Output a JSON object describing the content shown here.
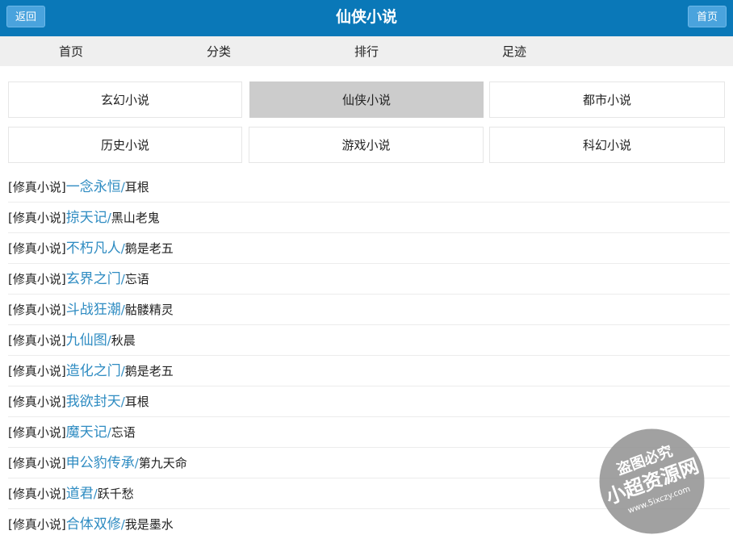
{
  "header": {
    "back_label": "返回",
    "title": "仙侠小说",
    "home_label": "首页",
    "bar_color": "#0a78b8"
  },
  "nav": {
    "items": [
      {
        "label": "首页"
      },
      {
        "label": "分类"
      },
      {
        "label": "排行"
      },
      {
        "label": "足迹"
      }
    ]
  },
  "categories": [
    {
      "label": "玄幻小说",
      "active": false
    },
    {
      "label": "仙侠小说",
      "active": true
    },
    {
      "label": "都市小说",
      "active": false
    },
    {
      "label": "历史小说",
      "active": false
    },
    {
      "label": "游戏小说",
      "active": false
    },
    {
      "label": "科幻小说",
      "active": false
    }
  ],
  "books": [
    {
      "tag": "[修真小说]",
      "title": "一念永恒",
      "sep": "/",
      "author": "耳根"
    },
    {
      "tag": "[修真小说]",
      "title": "掠天记",
      "sep": "/",
      "author": "黑山老鬼"
    },
    {
      "tag": "[修真小说]",
      "title": "不朽凡人",
      "sep": "/",
      "author": "鹅是老五"
    },
    {
      "tag": "[修真小说]",
      "title": "玄界之门",
      "sep": "/",
      "author": "忘语"
    },
    {
      "tag": "[修真小说]",
      "title": "斗战狂潮",
      "sep": "/",
      "author": "骷髅精灵"
    },
    {
      "tag": "[修真小说]",
      "title": "九仙图",
      "sep": "/",
      "author": "秋晨"
    },
    {
      "tag": "[修真小说]",
      "title": "造化之门",
      "sep": "/",
      "author": "鹅是老五"
    },
    {
      "tag": "[修真小说]",
      "title": "我欲封天",
      "sep": "/",
      "author": "耳根"
    },
    {
      "tag": "[修真小说]",
      "title": "魔天记",
      "sep": "/",
      "author": "忘语"
    },
    {
      "tag": "[修真小说]",
      "title": "申公豹传承",
      "sep": "/",
      "author": "第九天命"
    },
    {
      "tag": "[修真小说]",
      "title": "道君",
      "sep": "/",
      "author": "跃千愁"
    },
    {
      "tag": "[修真小说]",
      "title": "合体双修",
      "sep": "/",
      "author": "我是墨水"
    }
  ],
  "watermark": {
    "line1": "盗图必究",
    "line2": "小超资源网",
    "line3": "www.5ixczy.com"
  }
}
